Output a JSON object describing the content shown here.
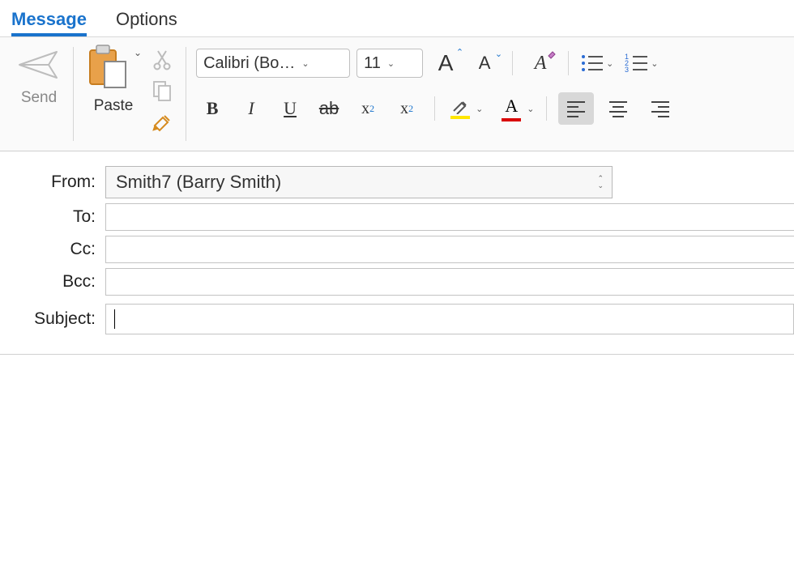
{
  "tabs": {
    "message": "Message",
    "options": "Options"
  },
  "ribbon": {
    "send": "Send",
    "paste": "Paste",
    "font_name": "Calibri (Bo…",
    "font_size": "11",
    "bold": "B",
    "italic": "I",
    "underline": "U",
    "strike": "ab",
    "subscript_base": "x",
    "subscript_sub": "2",
    "superscript_base": "x",
    "superscript_sup": "2",
    "grow_font": "A",
    "shrink_font": "A",
    "clear_fmt": "A",
    "font_color_letter": "A",
    "highlight_color": "#ffe600",
    "font_color": "#d90000",
    "numbered_digits": [
      "1",
      "2",
      "3"
    ]
  },
  "fields": {
    "from_label": "From:",
    "from_value": "Smith7 (Barry Smith)",
    "to_label": "To:",
    "to_value": "",
    "cc_label": "Cc:",
    "cc_value": "",
    "bcc_label": "Bcc:",
    "bcc_value": "",
    "subject_label": "Subject:",
    "subject_value": ""
  }
}
